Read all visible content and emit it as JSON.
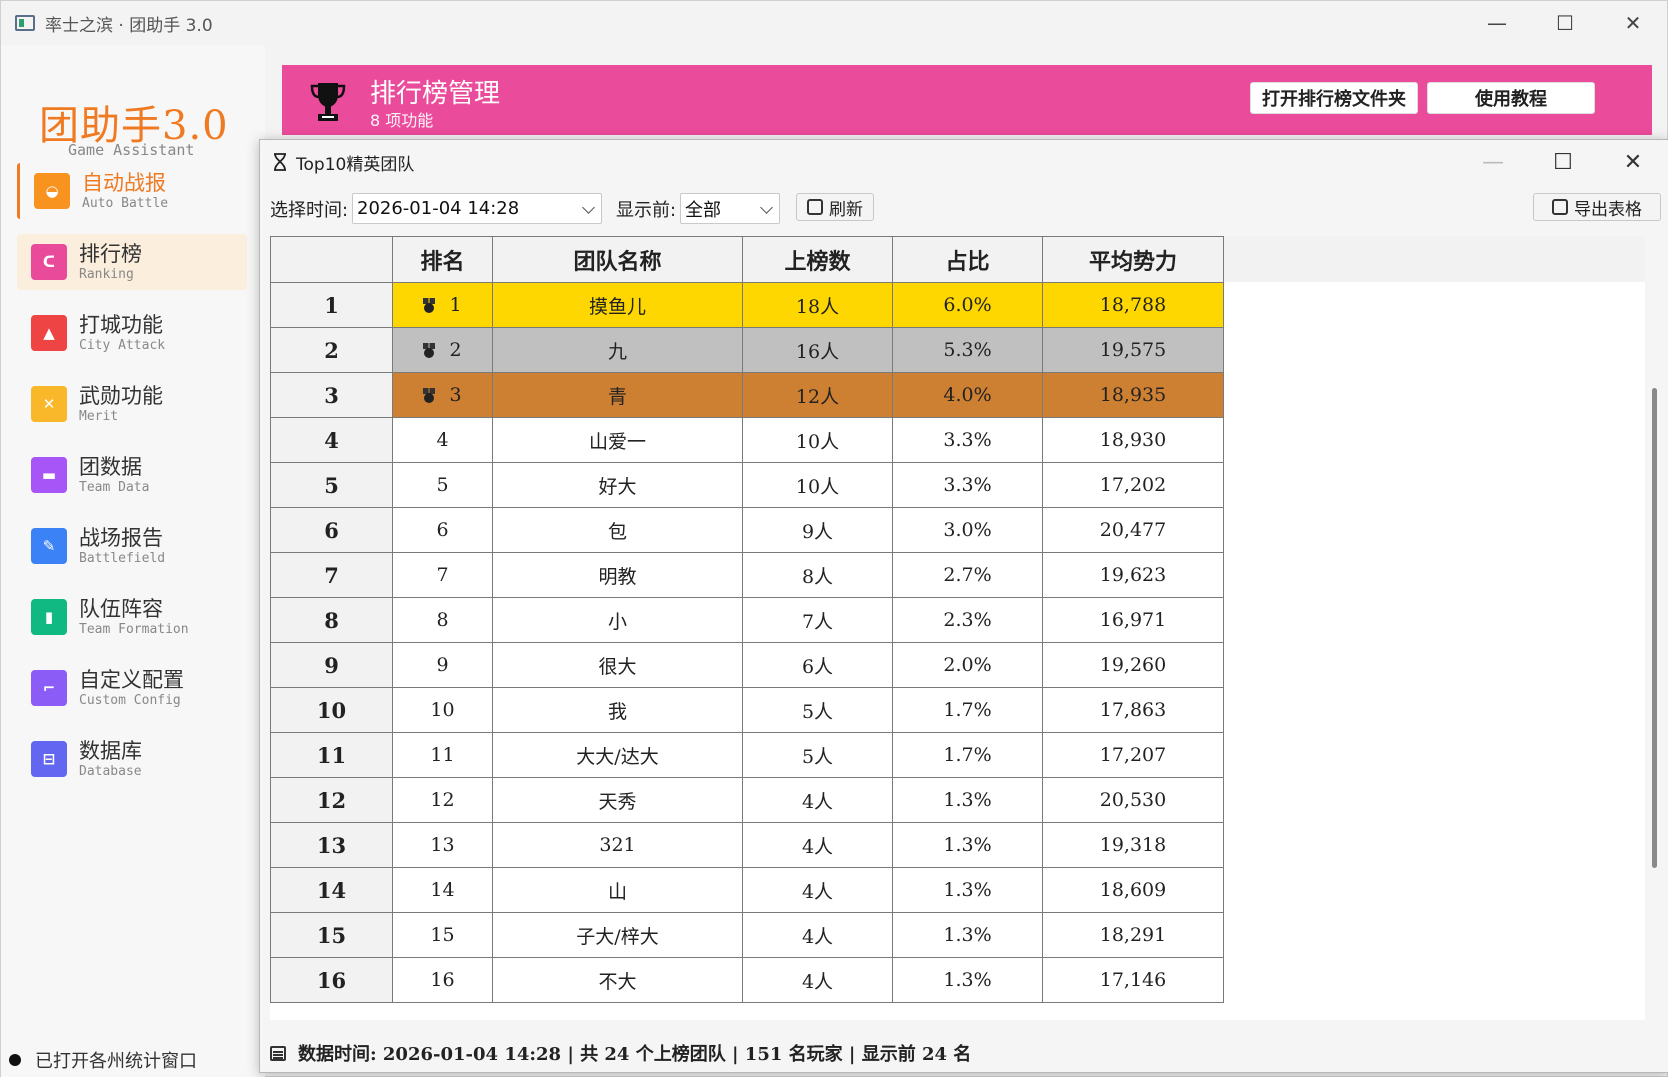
{
  "window": {
    "title": "率士之滨 · 团助手 3.0",
    "minimize": "—",
    "maximize": "☐",
    "close": "✕"
  },
  "sidebar": {
    "brand_title": "团助手3.0",
    "brand_subtitle": "Game Assistant",
    "items": [
      {
        "label": "自动战报",
        "sub": "Auto Battle",
        "icon": "battle-icon",
        "color": "#f7931e",
        "glyph": "◒"
      },
      {
        "label": "排行榜",
        "sub": "Ranking",
        "icon": "ranking-icon",
        "color": "#e94a9a",
        "glyph": "ᑕ"
      },
      {
        "label": "打城功能",
        "sub": "City Attack",
        "icon": "city-icon",
        "color": "#ef4444",
        "glyph": "▲"
      },
      {
        "label": "武勋功能",
        "sub": "Merit",
        "icon": "merit-icon",
        "color": "#f9b82a",
        "glyph": "✕"
      },
      {
        "label": "团数据",
        "sub": "Team Data",
        "icon": "team-data-icon",
        "color": "#a855f7",
        "glyph": "▬"
      },
      {
        "label": "战场报告",
        "sub": "Battlefield",
        "icon": "battlefield-icon",
        "color": "#3b82f6",
        "glyph": "✎"
      },
      {
        "label": "队伍阵容",
        "sub": "Team Formation",
        "icon": "formation-icon",
        "color": "#10b981",
        "glyph": "▮"
      },
      {
        "label": "自定义配置",
        "sub": "Custom Config",
        "icon": "config-icon",
        "color": "#8b5cf6",
        "glyph": "⌐"
      },
      {
        "label": "数据库",
        "sub": "Database",
        "icon": "database-icon",
        "color": "#6366f1",
        "glyph": "⊟"
      }
    ],
    "status": "已打开各州统计窗口"
  },
  "banner": {
    "title": "排行榜管理",
    "subtitle": "8 项功能",
    "btn_open_folder": "打开排行榜文件夹",
    "btn_tutorial": "使用教程",
    "color": "#ea4b9b"
  },
  "dialog": {
    "title": "Top10精英团队",
    "minimize": "—",
    "maximize": "☐",
    "close": "✕",
    "toolbar": {
      "time_label": "选择时间:",
      "time_value": "2026-01-04 14:28",
      "show_label": "显示前:",
      "show_value": "全部",
      "refresh": "刷新",
      "export": "导出表格"
    },
    "table": {
      "headers": [
        "",
        "排名",
        "团队名称",
        "上榜数",
        "占比",
        "平均势力"
      ],
      "rows": [
        {
          "idx": "1",
          "rank": "1",
          "name": "摸鱼儿",
          "count": "18人",
          "ratio": "6.0%",
          "power": "18,788"
        },
        {
          "idx": "2",
          "rank": "2",
          "name": "九",
          "count": "16人",
          "ratio": "5.3%",
          "power": "19,575"
        },
        {
          "idx": "3",
          "rank": "3",
          "name": "青",
          "count": "12人",
          "ratio": "4.0%",
          "power": "18,935"
        },
        {
          "idx": "4",
          "rank": "4",
          "name": "山爱一",
          "count": "10人",
          "ratio": "3.3%",
          "power": "18,930"
        },
        {
          "idx": "5",
          "rank": "5",
          "name": "好大",
          "count": "10人",
          "ratio": "3.3%",
          "power": "17,202"
        },
        {
          "idx": "6",
          "rank": "6",
          "name": "包",
          "count": "9人",
          "ratio": "3.0%",
          "power": "20,477"
        },
        {
          "idx": "7",
          "rank": "7",
          "name": "明教",
          "count": "8人",
          "ratio": "2.7%",
          "power": "19,623"
        },
        {
          "idx": "8",
          "rank": "8",
          "name": "小",
          "count": "7人",
          "ratio": "2.3%",
          "power": "16,971"
        },
        {
          "idx": "9",
          "rank": "9",
          "name": "很大",
          "count": "6人",
          "ratio": "2.0%",
          "power": "19,260"
        },
        {
          "idx": "10",
          "rank": "10",
          "name": "我",
          "count": "5人",
          "ratio": "1.7%",
          "power": "17,863"
        },
        {
          "idx": "11",
          "rank": "11",
          "name": "大大/达大",
          "count": "5人",
          "ratio": "1.7%",
          "power": "17,207"
        },
        {
          "idx": "12",
          "rank": "12",
          "name": "天秀",
          "count": "4人",
          "ratio": "1.3%",
          "power": "20,530"
        },
        {
          "idx": "13",
          "rank": "13",
          "name": "321",
          "count": "4人",
          "ratio": "1.3%",
          "power": "19,318"
        },
        {
          "idx": "14",
          "rank": "14",
          "name": "山",
          "count": "4人",
          "ratio": "1.3%",
          "power": "18,609"
        },
        {
          "idx": "15",
          "rank": "15",
          "name": "子大/梓大",
          "count": "4人",
          "ratio": "1.3%",
          "power": "18,291"
        },
        {
          "idx": "16",
          "rank": "16",
          "name": "不大",
          "count": "4人",
          "ratio": "1.3%",
          "power": "17,146"
        }
      ]
    },
    "status": {
      "text": "数据时间: 2026-01-04 14:28 | 共 24 个上榜团队 | 151 名玩家 | 显示前 24 名"
    }
  },
  "colors": {
    "gold": "#ffd700",
    "silver": "#c0c0c0",
    "bronze": "#cd7f32",
    "brand_orange": "#f07a22"
  }
}
